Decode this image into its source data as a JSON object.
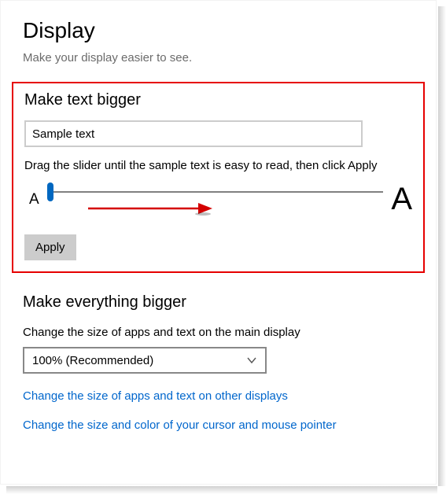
{
  "page": {
    "title": "Display",
    "subtitle": "Make your display easier to see."
  },
  "textSection": {
    "heading": "Make text bigger",
    "sampleValue": "Sample text",
    "instruction": "Drag the slider until the sample text is easy to read, then click Apply",
    "letterSmall": "A",
    "letterBig": "A",
    "applyLabel": "Apply"
  },
  "everythingSection": {
    "heading": "Make everything bigger",
    "desc": "Change the size of apps and text on the main display",
    "selected": "100% (Recommended)",
    "link1": "Change the size of apps and text on other displays",
    "link2": "Change the size and color of your cursor and mouse pointer"
  }
}
